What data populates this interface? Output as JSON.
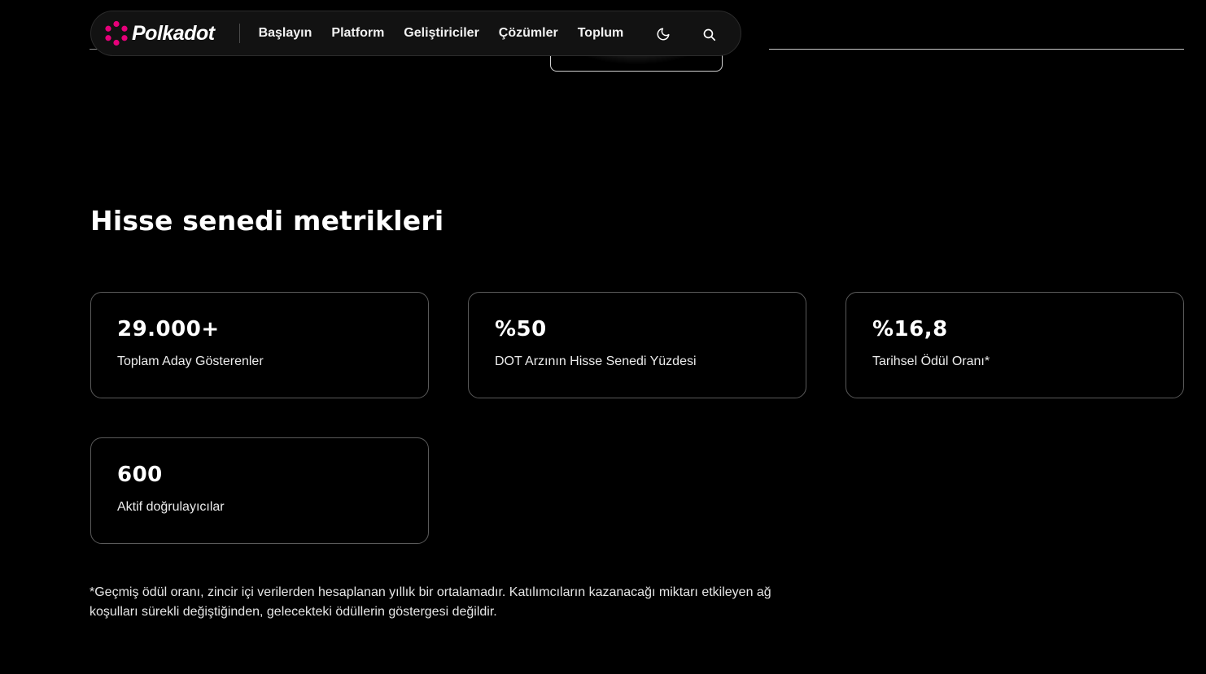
{
  "brand": {
    "name": "Polkadot",
    "accent_color": "#E6007A"
  },
  "nav": {
    "links": [
      "Başlayın",
      "Platform",
      "Geliştiriciler",
      "Çözümler",
      "Toplum"
    ],
    "theme_toggle_icon": "moon-icon",
    "search_icon": "search-icon"
  },
  "section": {
    "title": "Hisse senedi metrikleri"
  },
  "metrics": [
    {
      "value": "29.000+",
      "label": "Toplam Aday Gösterenler"
    },
    {
      "value": "%50",
      "label": "DOT Arzının Hisse Senedi Yüzdesi"
    },
    {
      "value": "%16,8",
      "label": "Tarihsel Ödül Oranı*"
    },
    {
      "value": "600",
      "label": "Aktif doğrulayıcılar"
    }
  ],
  "footnote": "*Geçmiş ödül oranı, zincir içi verilerden hesaplanan yıllık bir ortalamadır. Katılımcıların kazanacağı miktarı etkileyen ağ koşulları sürekli değiştiğinden, gelecekteki ödüllerin göstergesi değildir."
}
